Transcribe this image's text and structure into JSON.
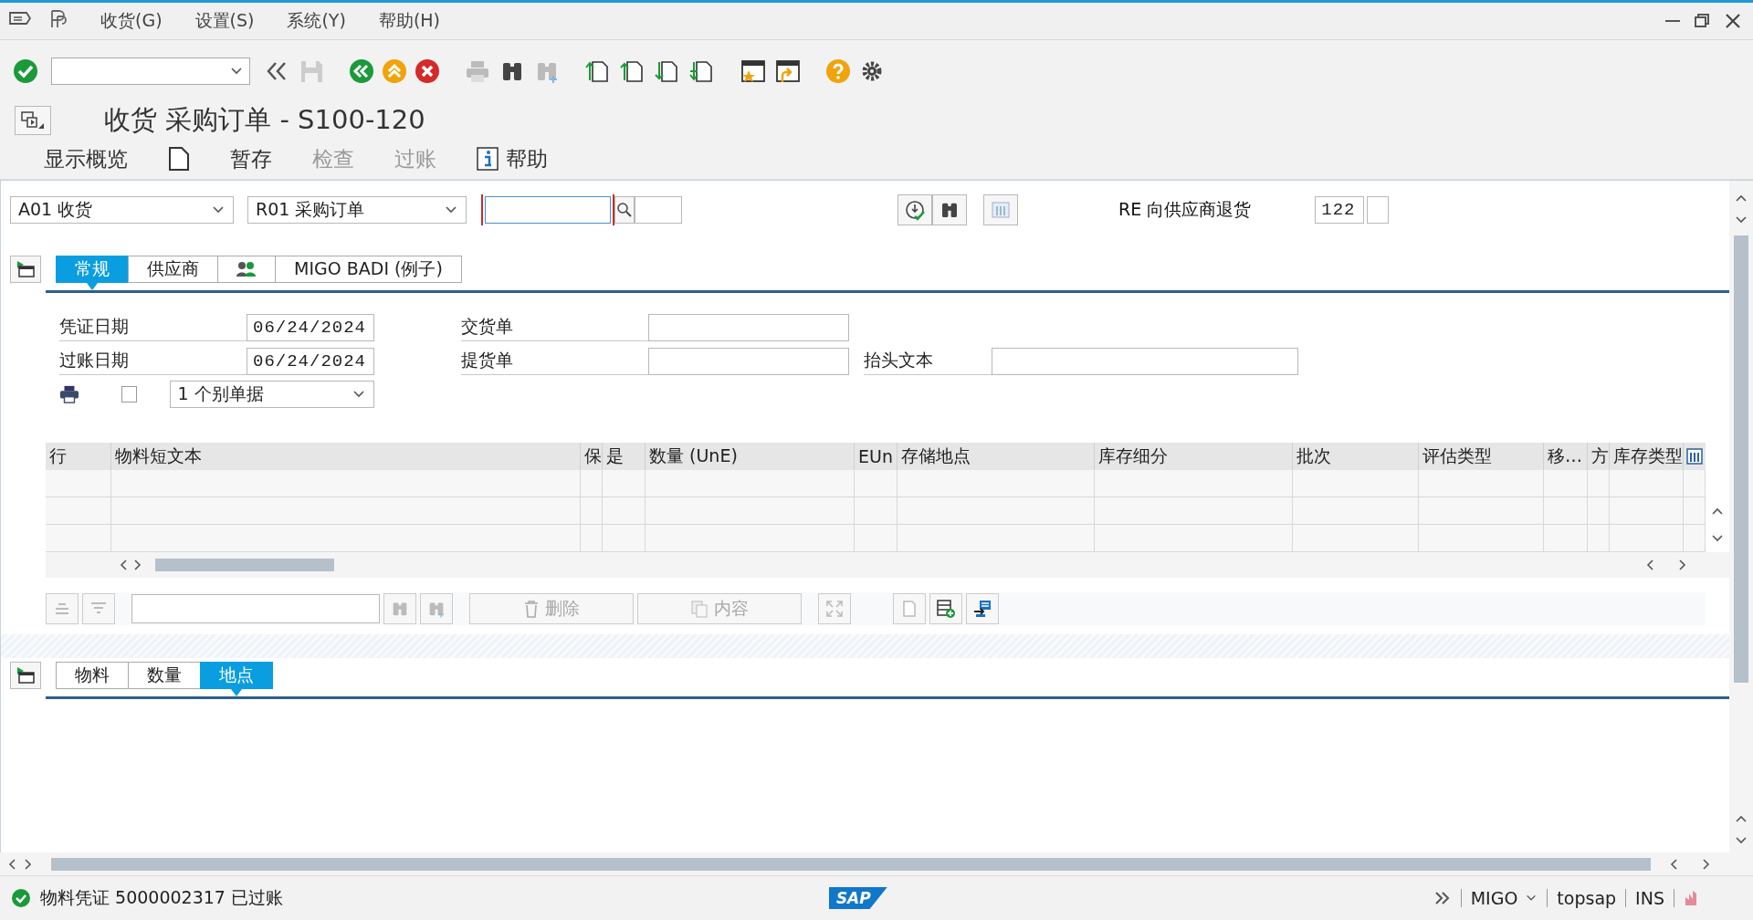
{
  "menu_bar": {
    "items": [
      {
        "label": "收货(G)"
      },
      {
        "label": "设置(S)"
      },
      {
        "label": "系统(Y)"
      },
      {
        "label": "帮助(H)"
      }
    ]
  },
  "title": "收货 采购订单 - S100-120",
  "app_toolbar": [
    {
      "kind": "text",
      "label": "显示概览",
      "disabled": false
    },
    {
      "kind": "page"
    },
    {
      "kind": "text",
      "label": "暂存",
      "disabled": false
    },
    {
      "kind": "text",
      "label": "检查",
      "disabled": true
    },
    {
      "kind": "text",
      "label": "过账",
      "disabled": true
    },
    {
      "kind": "help",
      "label": "帮助",
      "disabled": false
    }
  ],
  "header": {
    "action": "A01 收货",
    "reference": "R01 采购订单",
    "movement_type_label": "RE 向供应商退货",
    "movement_type": "122"
  },
  "header_tabs": [
    {
      "kind": "text",
      "label": "常规",
      "selected": true
    },
    {
      "kind": "text",
      "label": "供应商",
      "selected": false
    },
    {
      "kind": "people",
      "selected": false
    },
    {
      "kind": "text",
      "label": "MIGO BADI (例子)",
      "selected": false
    }
  ],
  "general": {
    "dates": [
      {
        "label": "凭证日期",
        "value": "06/24/2024"
      },
      {
        "label": "过账日期",
        "value": "06/24/2024"
      }
    ],
    "documents": [
      {
        "label": "交货单"
      },
      {
        "label": "提货单"
      }
    ],
    "header_text": {
      "label": "抬头文本"
    },
    "print_checked": false,
    "slip_type": "1 个别单据"
  },
  "items_table": {
    "columns": [
      "行",
      "物料短文本",
      "保",
      "是",
      "数量 (UnE)",
      "EUn",
      "存储地点",
      "库存细分",
      "批次",
      "评估类型",
      "移…",
      "方",
      "库存类型"
    ]
  },
  "table_toolbar": [
    {
      "label": "删除",
      "disabled": true
    },
    {
      "label": "内容",
      "disabled": true
    }
  ],
  "detail_tabs": [
    {
      "label": "物料",
      "selected": false
    },
    {
      "label": "数量",
      "selected": false
    },
    {
      "label": "地点",
      "selected": true
    }
  ],
  "status_bar": {
    "kind": "success",
    "message": "物料凭证 5000002317 已过账",
    "logo": "SAP",
    "transaction": "MIGO",
    "server": "topsap",
    "mode": "INS"
  }
}
